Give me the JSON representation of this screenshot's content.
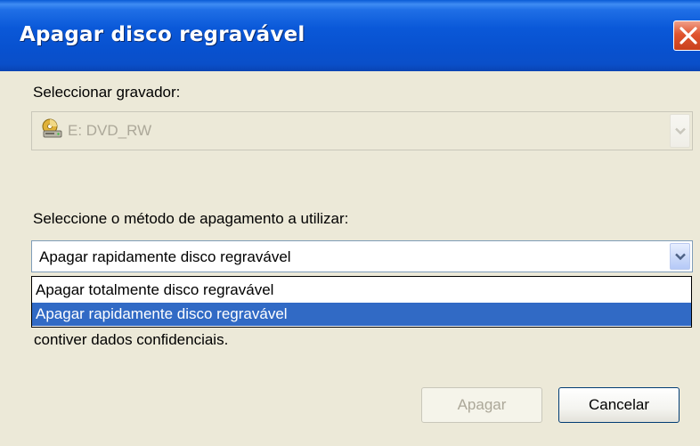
{
  "window": {
    "title": "Apagar disco regravável"
  },
  "recorder": {
    "label": "Seleccionar gravador:",
    "value": "E: DVD_RW",
    "disabled": true
  },
  "method": {
    "label": "Seleccione o método de apagamento a utilizar:",
    "value": "Apagar rapidamente disco regravável",
    "options": [
      {
        "label": "Apagar totalmente disco regravável",
        "selected": false
      },
      {
        "label": "Apagar rapidamente disco regravável",
        "selected": true
      }
    ]
  },
  "info_text": "contiver dados confidenciais.",
  "buttons": {
    "erase": "Apagar",
    "cancel": "Cancelar"
  }
}
